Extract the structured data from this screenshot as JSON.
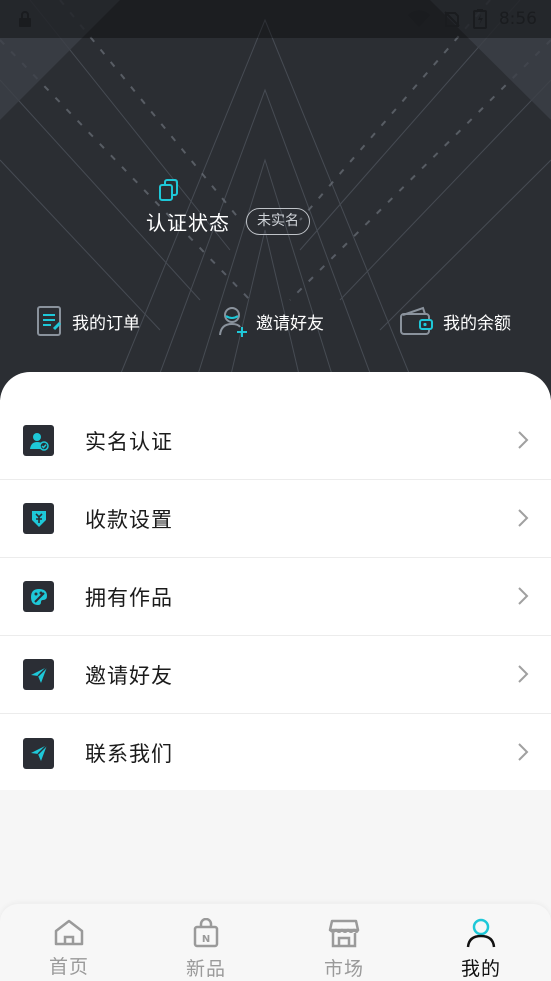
{
  "status_bar": {
    "time": "8:56",
    "icons": [
      "lock-icon",
      "wifi-icon",
      "no-sim-icon",
      "battery-icon"
    ]
  },
  "profile": {
    "auth_title": "认证状态",
    "auth_badge": "未实名"
  },
  "quick_actions": [
    {
      "label": "我的订单",
      "icon": "order-icon"
    },
    {
      "label": "邀请好友",
      "icon": "invite-user-icon"
    },
    {
      "label": "我的余额",
      "icon": "wallet-icon"
    }
  ],
  "menu": [
    {
      "label": "实名认证",
      "icon": "verify-user-icon"
    },
    {
      "label": "收款设置",
      "icon": "payment-icon"
    },
    {
      "label": "拥有作品",
      "icon": "palette-icon"
    },
    {
      "label": "邀请好友",
      "icon": "send-icon"
    },
    {
      "label": "联系我们",
      "icon": "send-icon"
    }
  ],
  "tabbar": [
    {
      "label": "首页",
      "icon": "home-icon",
      "active": false
    },
    {
      "label": "新品",
      "icon": "new-bag-icon",
      "active": false
    },
    {
      "label": "市场",
      "icon": "store-icon",
      "active": false
    },
    {
      "label": "我的",
      "icon": "user-icon",
      "active": true
    }
  ],
  "colors": {
    "accent": "#1ec8d8",
    "hero_bg": "#2a2d32",
    "icon_tile": "#2b2e35"
  }
}
